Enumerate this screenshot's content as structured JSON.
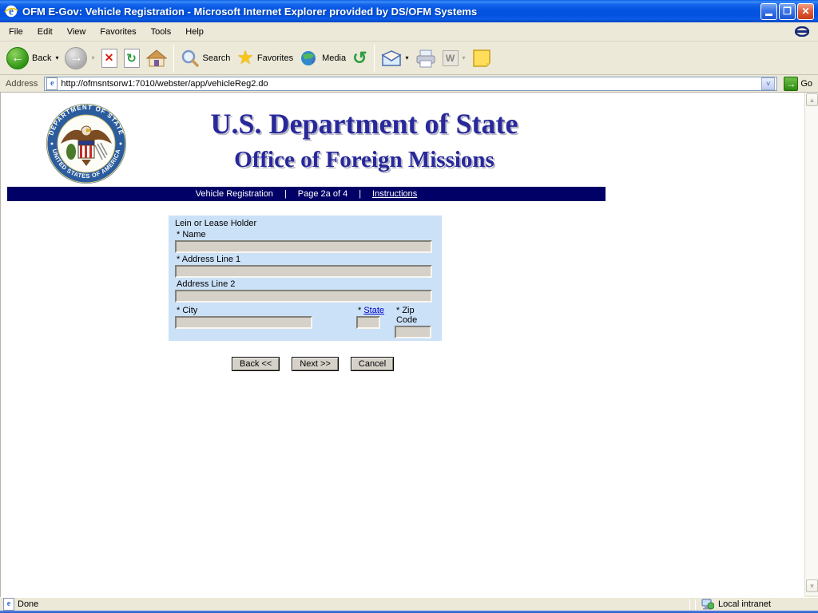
{
  "window": {
    "title": "OFM E-Gov: Vehicle Registration - Microsoft Internet Explorer provided by DS/OFM Systems"
  },
  "menu": {
    "items": [
      "File",
      "Edit",
      "View",
      "Favorites",
      "Tools",
      "Help"
    ]
  },
  "toolbar": {
    "back_label": "Back",
    "search_label": "Search",
    "favorites_label": "Favorites",
    "media_label": "Media"
  },
  "address": {
    "label": "Address",
    "url": "http://ofmsntsorw1:7010/webster/app/vehicleReg2.do",
    "go_label": "Go"
  },
  "header": {
    "title": "U.S. Department of State",
    "subtitle": "Office of Foreign Missions",
    "seal_top_text": "DEPARTMENT OF STATE",
    "seal_bottom_text": "UNITED STATES OF AMERICA"
  },
  "navbar": {
    "section": "Vehicle Registration",
    "sep": "|",
    "page": "Page 2a of 4",
    "instructions": "Instructions"
  },
  "form": {
    "group_label": "Lein or Lease Holder",
    "name_label": "* Name",
    "address1_label": "* Address Line 1",
    "address2_label": "Address Line 2",
    "city_label": "* City",
    "state_prefix": "* ",
    "state_link": "State",
    "zip_label": "* Zip Code",
    "values": {
      "name": "",
      "address1": "",
      "address2": "",
      "city": "",
      "state": "",
      "zip": ""
    }
  },
  "buttons": {
    "back": "Back <<",
    "next": "Next >>",
    "cancel": "Cancel"
  },
  "statusbar": {
    "status": "Done",
    "zone": "Local intranet"
  },
  "icons": {
    "ie_e": "e",
    "close": "✕",
    "restore": "❐",
    "back_arrow": "←",
    "forward_arrow": "→",
    "stop_glyph": "✕",
    "refresh_glyph": "↻",
    "history_glyph": "↺",
    "star": "★",
    "note_glyph": "♪",
    "caret": "▾",
    "chevron": "˅",
    "go_arrow": "→",
    "scroll_up": "▲",
    "scroll_down": "▼"
  },
  "colors": {
    "titlebar_blue": "#0353E0",
    "navy_bar": "#000066",
    "heading_blue": "#28289B",
    "form_bg": "#CBE1F7",
    "chrome_tan": "#ECE9D8",
    "input_gray": "#D5D1C8"
  }
}
